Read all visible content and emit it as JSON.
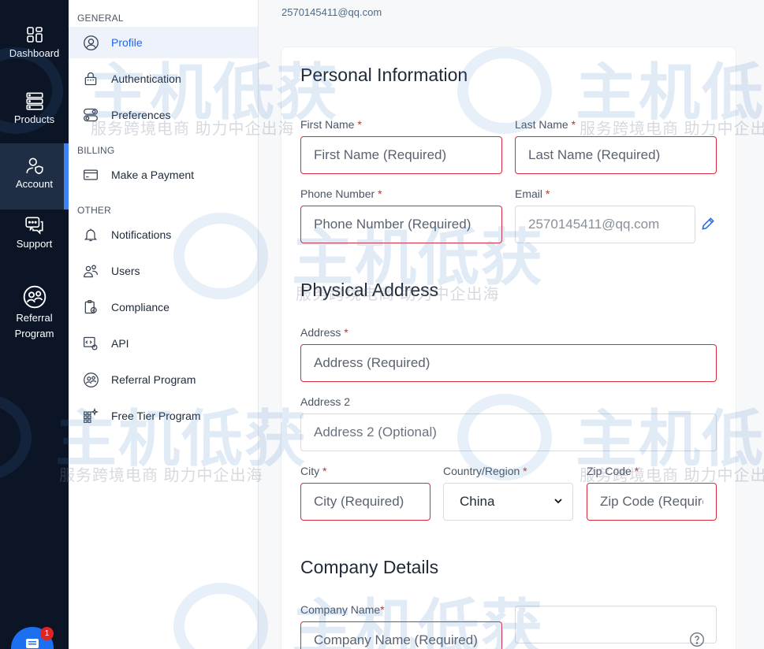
{
  "rail": {
    "items": [
      {
        "label": "Dashboard",
        "icon": "dashboard-grid-icon"
      },
      {
        "label": "Products",
        "icon": "server-stack-icon"
      },
      {
        "label": "Account",
        "icon": "user-shield-icon"
      },
      {
        "label": "Support",
        "icon": "chat-bubbles-icon"
      },
      {
        "label_line1": "Referral",
        "label_line2": "Program",
        "icon": "referral-people-icon"
      }
    ],
    "active": "Account",
    "chat_badge": "1"
  },
  "sidebar": {
    "sections": {
      "general": "GENERAL",
      "billing": "BILLING",
      "other": "OTHER"
    },
    "items": [
      {
        "label": "Profile",
        "icon": "user-circle-icon"
      },
      {
        "label": "Authentication",
        "icon": "lock-icon"
      },
      {
        "label": "Preferences",
        "icon": "toggle-icon"
      },
      {
        "label": "Make a Payment",
        "icon": "credit-card-icon"
      },
      {
        "label": "Notifications",
        "icon": "bell-icon"
      },
      {
        "label": "Users",
        "icon": "users-icon"
      },
      {
        "label": "Compliance",
        "icon": "clipboard-check-icon"
      },
      {
        "label": "API",
        "icon": "code-gear-icon"
      },
      {
        "label": "Referral Program",
        "icon": "referral-icon"
      },
      {
        "label": "Free Tier Program",
        "icon": "grid-sparkle-icon"
      }
    ],
    "active": "Profile"
  },
  "header": {
    "email": "2570145411@qq.com"
  },
  "personal": {
    "title": "Personal Information",
    "first_name": {
      "label": "First Name",
      "placeholder": "First Name (Required)"
    },
    "last_name": {
      "label": "Last Name",
      "placeholder": "Last Name (Required)"
    },
    "phone": {
      "label": "Phone Number",
      "placeholder": "Phone Number (Required)"
    },
    "email": {
      "label": "Email",
      "value": "2570145411@qq.com"
    }
  },
  "address": {
    "title": "Physical Address",
    "address": {
      "label": "Address",
      "placeholder": "Address (Required)"
    },
    "address2": {
      "label": "Address 2",
      "placeholder": "Address 2 (Optional)"
    },
    "city": {
      "label": "City",
      "placeholder": "City (Required)"
    },
    "country": {
      "label": "Country/Region",
      "value": "China"
    },
    "zip": {
      "label": "Zip Code",
      "placeholder": "Zip Code (Required)"
    }
  },
  "company": {
    "title": "Company Details",
    "name": {
      "label": "Company Name",
      "placeholder": "Company Name (Required)"
    }
  },
  "required_mark": "*",
  "watermark": {
    "brand": "主机低获",
    "slogan": "服务跨境电商 助力中企出海"
  },
  "colors": {
    "rail_bg": "#0b1526",
    "accent": "#2563eb",
    "error": "#d72b3b"
  }
}
